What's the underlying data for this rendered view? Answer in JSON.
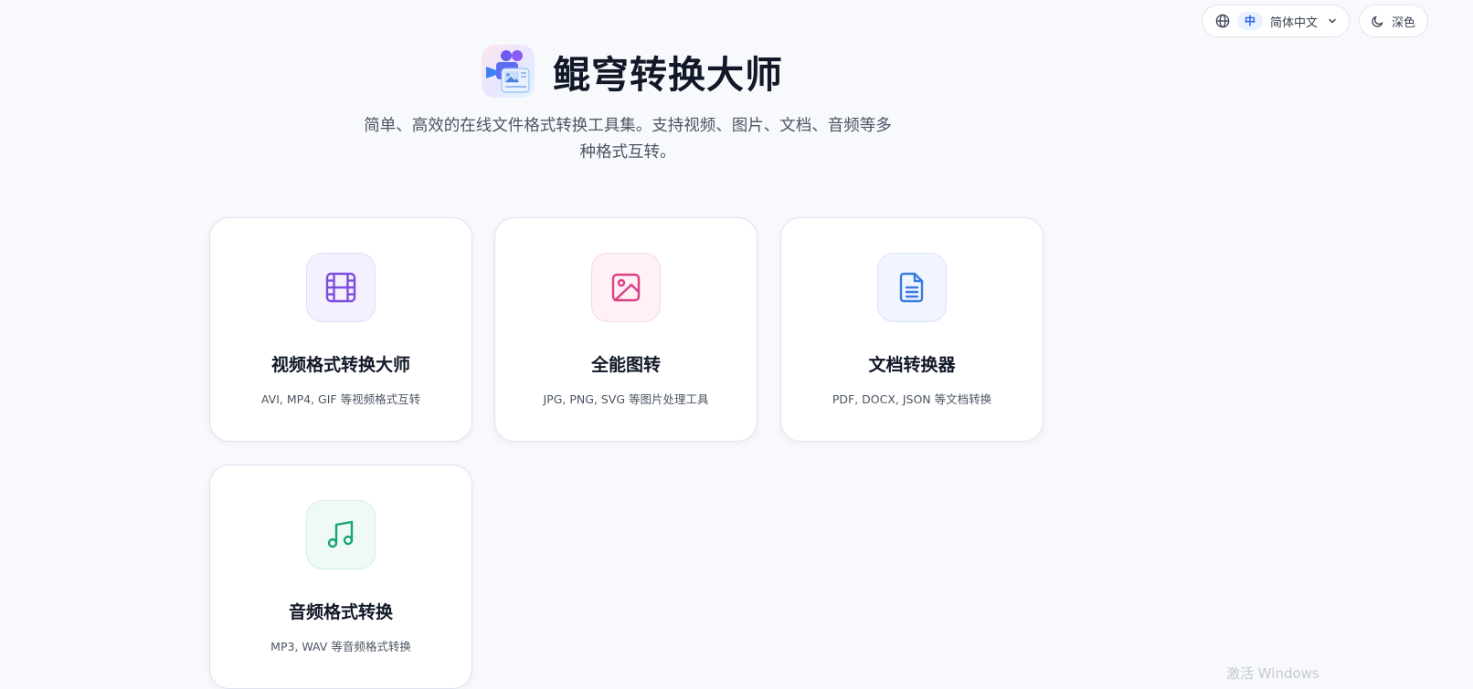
{
  "header": {
    "language": {
      "badge": "中",
      "label": "简体中文"
    },
    "theme": {
      "label": "深色"
    }
  },
  "hero": {
    "title": "鲲穹转换大师",
    "subtitle": "简单、高效的在线文件格式转换工具集。支持视频、图片、文档、音频等多种格式互转。"
  },
  "tools": [
    {
      "title": "视频格式转换大师",
      "description": "AVI, MP4, GIF 等视频格式互转",
      "icon": "film-icon",
      "color": "#7c4ddd"
    },
    {
      "title": "全能图转",
      "description": "JPG, PNG, SVG 等图片处理工具",
      "icon": "image-icon",
      "color": "#db3f86"
    },
    {
      "title": "文档转换器",
      "description": "PDF, DOCX, JSON 等文档转换",
      "icon": "document-icon",
      "color": "#3b7be0"
    },
    {
      "title": "音频格式转换",
      "description": "MP3, WAV 等音频格式转换",
      "icon": "music-note-icon",
      "color": "#16a57a"
    }
  ],
  "overlay": {
    "watermark": "激活 Windows"
  }
}
